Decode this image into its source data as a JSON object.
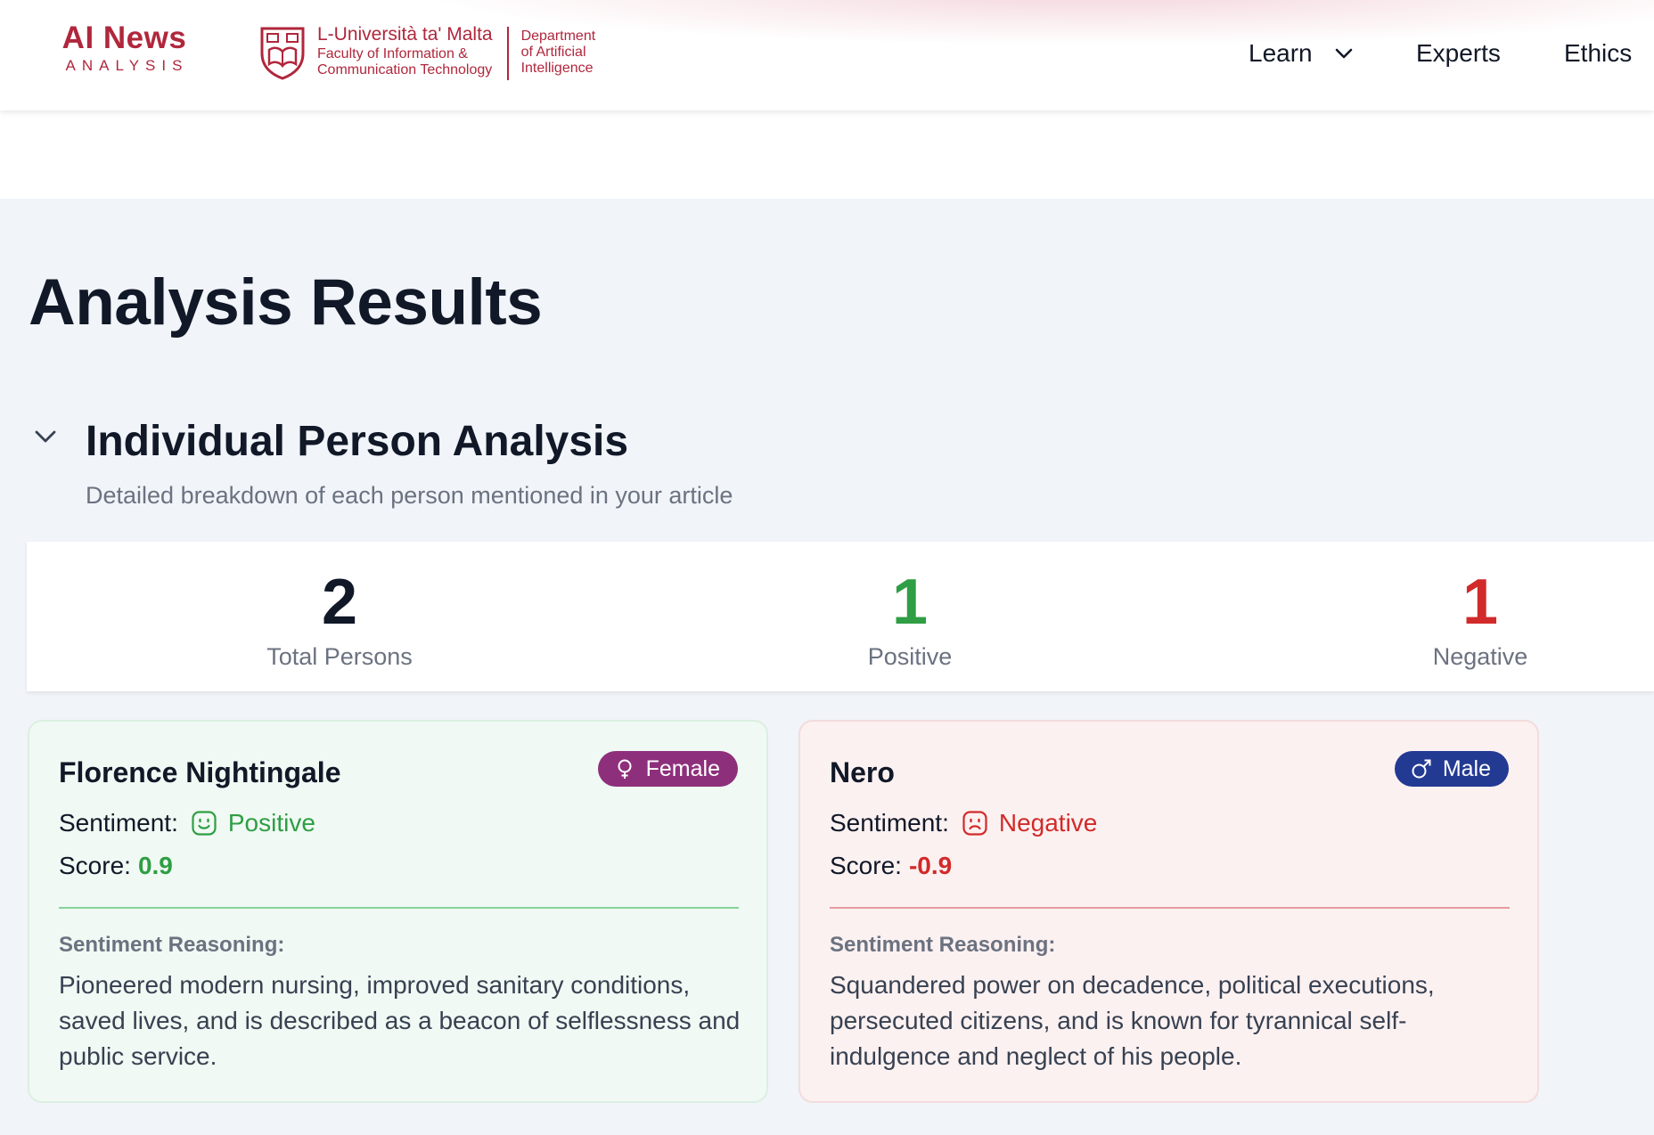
{
  "header": {
    "brand_title": "AI News",
    "brand_subtitle": "ANALYSIS",
    "university": {
      "name": "L-Università ta' Malta",
      "faculty_line1": "Faculty of Information &",
      "faculty_line2": "Communication Technology",
      "dept_line1": "Department",
      "dept_line2": "of Artificial",
      "dept_line3": "Intelligence"
    },
    "nav": {
      "learn": "Learn",
      "experts": "Experts",
      "ethics": "Ethics"
    }
  },
  "page": {
    "title": "Analysis Results"
  },
  "section": {
    "title": "Individual Person Analysis",
    "subtitle": "Detailed breakdown of each person mentioned in your article"
  },
  "stats": {
    "total": {
      "value": "2",
      "label": "Total Persons"
    },
    "positive": {
      "value": "1",
      "label": "Positive"
    },
    "negative": {
      "value": "1",
      "label": "Negative"
    }
  },
  "persons": [
    {
      "name": "Florence Nightingale",
      "gender": "Female",
      "sentiment_label": "Sentiment:",
      "sentiment": "Positive",
      "score_label": "Score:",
      "score": "0.9",
      "reasoning_label": "Sentiment Reasoning:",
      "reasoning": "Pioneered modern nursing, improved sanitary conditions, saved lives, and is described as a beacon of selflessness and public service.",
      "icons": {
        "gender": "female-icon",
        "sentiment": "smile-face-icon"
      }
    },
    {
      "name": "Nero",
      "gender": "Male",
      "sentiment_label": "Sentiment:",
      "sentiment": "Negative",
      "score_label": "Score:",
      "score": "-0.9",
      "reasoning_label": "Sentiment Reasoning:",
      "reasoning": "Squandered power on decadence, political executions, persecuted citizens, and is known for tyrannical self-indulgence and neglect of his people.",
      "icons": {
        "gender": "male-icon",
        "sentiment": "frown-face-icon"
      }
    }
  ],
  "colors": {
    "brand": "#b0273c",
    "positive": "#2f9e44",
    "negative": "#d22a2a",
    "female_badge": "#8e2f7c",
    "male_badge": "#233a93"
  }
}
